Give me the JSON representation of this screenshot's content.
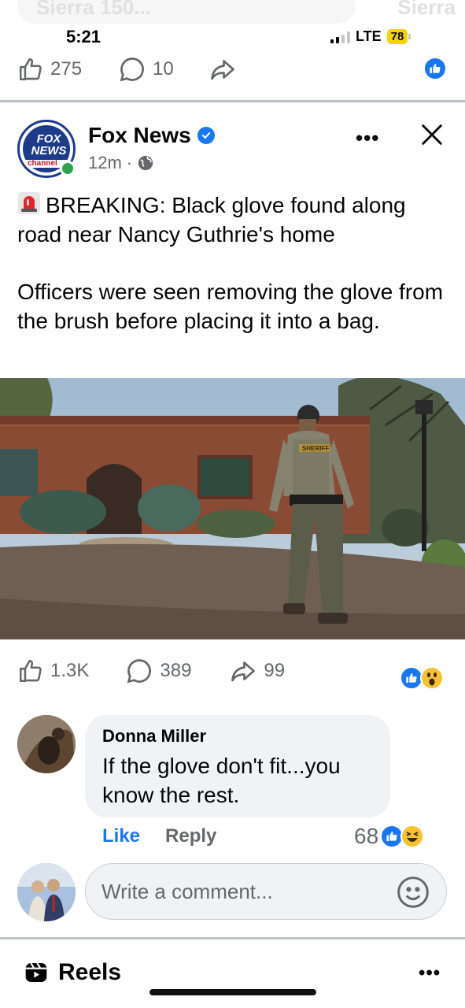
{
  "ghost": {
    "left": "Sierra 150...",
    "right": "Sierra"
  },
  "status_bar": {
    "time": "5:21",
    "network": "LTE",
    "battery": "78"
  },
  "prev_post": {
    "likes": "275",
    "comments": "10"
  },
  "post": {
    "page_name": "Fox News",
    "time": "12m",
    "avatar_text": "FOX NEWS",
    "avatar_band": "channel",
    "headline": "BREAKING: Black glove found along road near Nancy Guthrie's home",
    "body": "Officers were seen removing the glove from the brush before placing it into a bag.",
    "vest_label": "SHERIFF",
    "likes": "1.3K",
    "comments": "389",
    "shares": "99"
  },
  "comment": {
    "author": "Donna Miller",
    "text": "If the glove don't fit...you know the rest.",
    "like_label": "Like",
    "reply_label": "Reply",
    "reaction_count": "68"
  },
  "composer": {
    "placeholder": "Write a comment..."
  },
  "reels": {
    "title": "Reels"
  },
  "colors": {
    "brand_blue": "#1877f2",
    "muted": "#65676b",
    "wow_yellow": "#f7c22f",
    "online": "#31a24c"
  }
}
